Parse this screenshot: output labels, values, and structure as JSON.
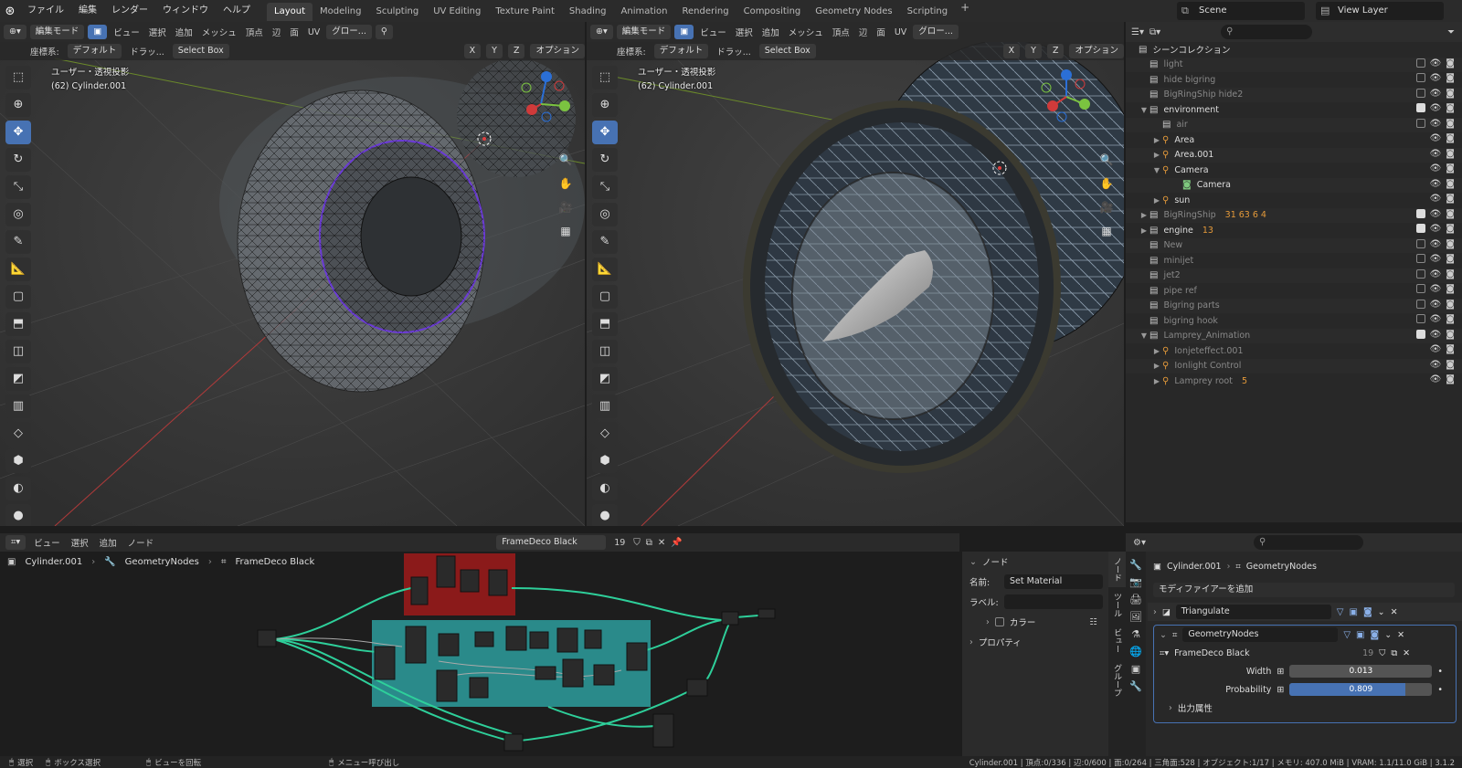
{
  "menu": [
    "ファイル",
    "編集",
    "レンダー",
    "ウィンドウ",
    "ヘルプ"
  ],
  "workspaces": [
    "Layout",
    "Modeling",
    "Sculpting",
    "UV Editing",
    "Texture Paint",
    "Shading",
    "Animation",
    "Rendering",
    "Compositing",
    "Geometry Nodes",
    "Scripting"
  ],
  "active_workspace": "Layout",
  "scene": "Scene",
  "view_layer": "View Layer",
  "vp_header": {
    "mode": "編集モード",
    "view": "ビュー",
    "select": "選択",
    "add": "追加",
    "mesh": "メッシュ",
    "vertex": "頂点",
    "edge": "辺",
    "face": "面",
    "uv": "UV",
    "transform": "グロー...",
    "coord_label": "座標系:",
    "coord_value": "デフォルト",
    "drag": "ドラッ...",
    "select_box": "Select Box",
    "x": "X",
    "y": "Y",
    "z": "Z",
    "options": "オプション"
  },
  "viewport_left": {
    "projection": "ユーザー・透視投影",
    "object": "(62) Cylinder.001"
  },
  "viewport_right": {
    "projection": "ユーザー・透視投影",
    "object": "(62) Cylinder.001"
  },
  "outliner": {
    "search_placeholder": "",
    "root": "シーンコレクション",
    "rows": [
      {
        "label": "light",
        "dim": true,
        "indent": 1,
        "checked": false
      },
      {
        "label": "hide bigring",
        "dim": true,
        "indent": 1,
        "checked": false
      },
      {
        "label": "BigRingShip hide2",
        "dim": true,
        "indent": 1,
        "checked": false
      },
      {
        "label": "environment",
        "dim": false,
        "indent": 1,
        "checked": true,
        "expand": "▼"
      },
      {
        "label": "air",
        "dim": true,
        "indent": 2,
        "checked": false
      },
      {
        "label": "Area",
        "dim": false,
        "indent": 2,
        "obj": true,
        "expand": "▶"
      },
      {
        "label": "Area.001",
        "dim": false,
        "indent": 2,
        "obj": true,
        "expand": "▶"
      },
      {
        "label": "Camera",
        "dim": false,
        "indent": 2,
        "obj": true,
        "expand": "▼"
      },
      {
        "label": "Camera",
        "dim": false,
        "indent": 3,
        "data": true
      },
      {
        "label": "sun",
        "dim": false,
        "indent": 2,
        "obj": true,
        "expand": "▶"
      },
      {
        "label": "BigRingShip",
        "dim": true,
        "indent": 1,
        "checked": true,
        "expand": "▶",
        "badges": "31  63  6  4"
      },
      {
        "label": "engine",
        "dim": false,
        "indent": 1,
        "checked": true,
        "expand": "▶",
        "badges": "13"
      },
      {
        "label": "New",
        "dim": true,
        "indent": 1,
        "checked": false
      },
      {
        "label": "minijet",
        "dim": true,
        "indent": 1,
        "checked": false
      },
      {
        "label": "jet2",
        "dim": true,
        "indent": 1,
        "checked": false
      },
      {
        "label": "pipe ref",
        "dim": true,
        "indent": 1,
        "checked": false
      },
      {
        "label": "Bigring parts",
        "dim": true,
        "indent": 1,
        "checked": false
      },
      {
        "label": "bigring hook",
        "dim": true,
        "indent": 1,
        "checked": false
      },
      {
        "label": "Lamprey_Animation",
        "dim": true,
        "indent": 1,
        "checked": true,
        "expand": "▼"
      },
      {
        "label": "Ionjeteffect.001",
        "dim": true,
        "indent": 2,
        "obj": true,
        "expand": "▶"
      },
      {
        "label": "Ionlight Control",
        "dim": true,
        "indent": 2,
        "obj": true,
        "expand": "▶"
      },
      {
        "label": "Lamprey root",
        "dim": true,
        "indent": 2,
        "obj": true,
        "expand": "▶",
        "badges": "5"
      }
    ]
  },
  "node_editor": {
    "menu": [
      "ビュー",
      "選択",
      "追加",
      "ノード"
    ],
    "node_group": "FrameDeco Black",
    "users": "19",
    "breadcrumb": [
      "Cylinder.001",
      "GeometryNodes",
      "FrameDeco Black"
    ]
  },
  "npanel": {
    "section": "ノード",
    "name_label": "名前:",
    "name_value": "Set Material",
    "label_label": "ラベル:",
    "label_value": "",
    "color": "カラー",
    "properties": "プロパティ",
    "tabs": [
      "ノード",
      "ツール",
      "ビュー",
      "グループ"
    ]
  },
  "properties": {
    "breadcrumb": [
      "Cylinder.001",
      "GeometryNodes"
    ],
    "add_modifier": "モディファイアーを追加",
    "mod1": "Triangulate",
    "mod2": "GeometryNodes",
    "node_group": "FrameDeco Black",
    "users": "19",
    "width_label": "Width",
    "width_value": "0.013",
    "prob_label": "Probability",
    "prob_value": "0.809",
    "prob_fraction": 0.809,
    "output_attrs": "出力属性"
  },
  "status": {
    "select": "選択",
    "box_select": "ボックス選択",
    "rotate_view": "ビューを回転",
    "menu_call": "メニュー呼び出し",
    "stats": "Cylinder.001 | 頂点:0/336 | 辺:0/600 | 面:0/264 | 三角面:528 | オブジェクト:1/17 | メモリ: 407.0 MiB | VRAM: 1.1/11.0 GiB | 3.1.2"
  },
  "colors": {
    "accent": "#4772b3",
    "frame_red": "#8b1a1a",
    "frame_teal": "#2a8a8a",
    "wire": "#2ecf9a"
  }
}
